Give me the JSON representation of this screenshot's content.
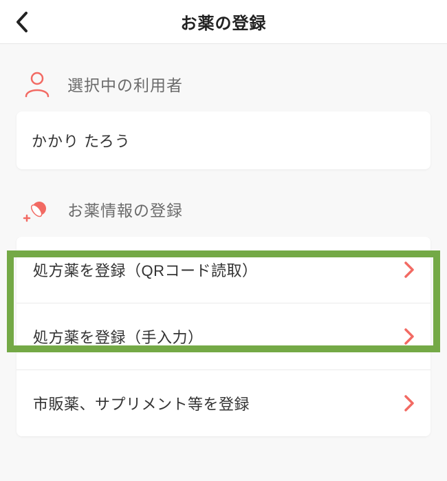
{
  "header": {
    "title": "お薬の登録"
  },
  "sections": {
    "user": {
      "label": "選択中の利用者",
      "value": "かかり たろう"
    },
    "medicine": {
      "label": "お薬情報の登録",
      "options": [
        {
          "label": "処方薬を登録（QRコード読取）"
        },
        {
          "label": "処方薬を登録（手入力）"
        },
        {
          "label": "市販薬、サプリメント等を登録"
        }
      ]
    }
  },
  "colors": {
    "accent": "#f26a63",
    "highlight": "#74a946",
    "subtext": "#6b6b6b"
  }
}
